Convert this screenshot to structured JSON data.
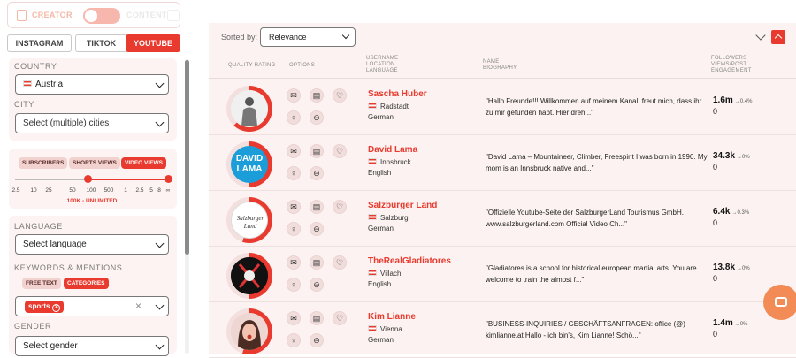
{
  "mode_toggle": {
    "creator": "CREATOR",
    "content": "CONTENT"
  },
  "platform_tabs": [
    {
      "label": "INSTAGRAM",
      "active": false
    },
    {
      "label": "TIKTOK",
      "active": false
    },
    {
      "label": "YOUTUBE",
      "active": true
    }
  ],
  "filters": {
    "country_label": "COUNTRY",
    "country_value": "Austria",
    "city_label": "CITY",
    "city_placeholder": "Select (multiple) cities",
    "metric_chips": [
      "SUBSCRIBERS",
      "SHORTS VIEWS",
      "VIDEO VIEWS"
    ],
    "active_metric": "VIDEO VIEWS",
    "slider_ticks": [
      "2.5",
      "10",
      "25",
      "50",
      "100",
      "500",
      "1",
      "2.5",
      "5",
      "8",
      "∞"
    ],
    "range_label": "100K - UNLIMITED",
    "language_label": "LANGUAGE",
    "language_placeholder": "Select language",
    "keywords_label": "KEYWORDS & MENTIONS",
    "keyword_chips": [
      "FREE TEXT",
      "CATEGORIES"
    ],
    "active_keyword": "CATEGORIES",
    "selected_tag": "sports",
    "clear_icon": "×",
    "gender_label": "GENDER",
    "gender_placeholder": "Select gender"
  },
  "toolbar": {
    "sorted_by_label": "Sorted by:",
    "sort_value": "Relevance"
  },
  "table_headers": {
    "quality": "QUALITY RATING",
    "options": "OPTIONS",
    "user": [
      "USERNAME",
      "LOCATION",
      "LANGUAGE"
    ],
    "name": [
      "NAME",
      "BIOGRAPHY"
    ],
    "followers": [
      "FOLLOWERS",
      "VIEWS/POST",
      "ENGAGEMENT"
    ]
  },
  "rows": [
    {
      "username": "Sascha Huber",
      "location": "Radstadt",
      "language": "German",
      "bio1": "\"Hallo Freunde!!! Willkommen auf meinem Kanal, freut mich, dass ihr",
      "bio2": "zu mir gefunden habt. Hier dreh...\"",
      "followers": "1.6m",
      "trend": "0.4%",
      "engagement": "0",
      "quality": 0.62
    },
    {
      "username": "David Lama",
      "location": "Innsbruck",
      "language": "English",
      "bio1": "\"David Lama – Mountaineer, Climber, Freespirit I was born in 1990. My",
      "bio2": "mom is an Innsbruck native and...\"",
      "followers": "34.3k",
      "trend": "0%",
      "engagement": "0",
      "quality": 0.5,
      "avatar_text1": "DAVID",
      "avatar_text2": "LAMA"
    },
    {
      "username": "Salzburger Land",
      "location": "Salzburg",
      "language": "German",
      "bio1": "\"Offizielle Youtube-Seite der SalzburgerLand Tourismus GmbH.",
      "bio2": "www.salzburgerland.com Official Video Ch...\"",
      "followers": "6.4k",
      "trend": "0.3%",
      "engagement": "0",
      "quality": 0.55
    },
    {
      "username": "TheRealGladiatores",
      "location": "Villach",
      "language": "English",
      "bio1": "\"Gladiatores is a school for historical european martial arts. You are",
      "bio2": "welcome to train the almost f...\"",
      "followers": "13.8k",
      "trend": "0%",
      "engagement": "0",
      "quality": 0.5
    },
    {
      "username": "Kim Lianne",
      "location": "Vienna",
      "language": "German",
      "bio1": "\"BUSINESS-INQUIRIES / GESCHÄFTSANFRAGEN: office (@)",
      "bio2": "kimlianne.at Hallo - ich bin's, Kim Lianne! Schö...\"",
      "followers": "1.4m",
      "trend": "0%",
      "engagement": "0",
      "quality": 0.55
    }
  ],
  "colors": {
    "accent": "#e83a2e",
    "panel": "#fdf3f2",
    "main_bg": "#fbf2f1",
    "chat": "#f28b55"
  }
}
